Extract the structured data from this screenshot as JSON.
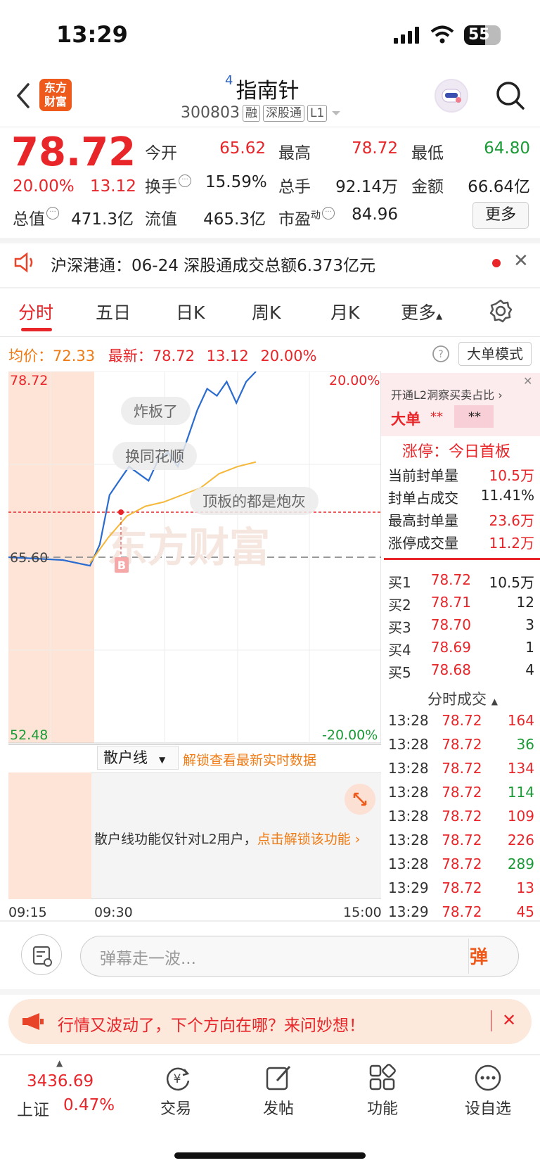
{
  "status_bar": {
    "time": "13:29",
    "battery": "55"
  },
  "header": {
    "logo_text": "东方财富",
    "stock_index": "4",
    "stock_name": "指南针",
    "stock_code": "300803",
    "tags": [
      "融",
      "深股通",
      "L1"
    ]
  },
  "quote": {
    "price": "78.72",
    "change_pct": "20.00%",
    "change": "13.12",
    "stats": [
      {
        "label": "今开",
        "value": "65.62",
        "color": "red"
      },
      {
        "label": "最高",
        "value": "78.72",
        "color": "red"
      },
      {
        "label": "最低",
        "value": "64.80",
        "color": "green"
      },
      {
        "label": "换手",
        "value": "15.59%",
        "color": "black"
      },
      {
        "label": "总手",
        "value": "92.14万",
        "color": "black"
      },
      {
        "label": "金额",
        "value": "66.64亿",
        "color": "black"
      },
      {
        "label": "总值",
        "value": "471.3亿",
        "color": "black"
      },
      {
        "label": "流值",
        "value": "465.3亿",
        "color": "black"
      },
      {
        "label": "市盈",
        "label_sup": "动",
        "value": "84.96",
        "color": "black"
      }
    ],
    "more_label": "更多"
  },
  "notice": {
    "text": "沪深港通：06-24 深股通成交总额6.373亿元"
  },
  "tabs": [
    "分时",
    "五日",
    "日K",
    "周K",
    "月K",
    "更多"
  ],
  "chart": {
    "avg_label": "均价：",
    "avg_value": "72.33",
    "latest_label": "最新：",
    "latest_value": "78.72",
    "latest_change": "13.12",
    "latest_pct": "20.00%",
    "big_order_mode": "大单模式",
    "y_top": "78.72",
    "y_mid": "65.60",
    "y_bottom": "52.48",
    "pct_top": "20.00%",
    "pct_bottom": "-20.00%",
    "danmaku": [
      "炸板了",
      "换同花顺",
      "顶板的都是炮灰"
    ],
    "watermark": "东方财富",
    "buy_marker": "B",
    "sub_chart_select": "散户线",
    "sub_chart_unlock": "解锁查看最新实时数据",
    "sub_chart_msg": "散户线功能仅针对L2用户，",
    "sub_chart_msg_link": "点击解锁该功能",
    "time_start": "09:15",
    "time_open": "09:30",
    "time_end": "15:00"
  },
  "chart_data": {
    "type": "line",
    "ylim": [
      52.48,
      78.72
    ],
    "series": [
      {
        "values": [
          65.6,
          65.5,
          65.4,
          65.0,
          66.5,
          70.0,
          71.0,
          72.0,
          71.5,
          71.0,
          72.5,
          73.0,
          72.0,
          74.0,
          76.0,
          77.5,
          77.0,
          78.0,
          76.5,
          78.0,
          78.72
        ]
      },
      {
        "values": [
          65.2,
          67.0,
          68.5,
          69.2,
          69.5,
          70.0,
          70.5,
          71.5,
          72.0,
          72.33
        ]
      }
    ]
  },
  "right_panel": {
    "l2_promo": "开通L2洞察买卖占比",
    "big_order_label": "大单",
    "big_order_val1": "**",
    "big_order_val2": "**",
    "limit_up_title": "涨停：今日首板",
    "limit_rows": [
      {
        "label": "当前封单量",
        "value": "10.5万"
      },
      {
        "label": "封单占成交",
        "value": "11.41%"
      },
      {
        "label": "最高封单量",
        "value": "23.6万"
      },
      {
        "label": "涨停成交量",
        "value": "11.2万"
      }
    ],
    "bids": [
      {
        "label": "买1",
        "price": "78.72",
        "vol": "10.5万"
      },
      {
        "label": "买2",
        "price": "78.71",
        "vol": "12"
      },
      {
        "label": "买3",
        "price": "78.70",
        "vol": "3"
      },
      {
        "label": "买4",
        "price": "78.69",
        "vol": "1"
      },
      {
        "label": "买5",
        "price": "78.68",
        "vol": "4"
      }
    ],
    "trades_title": "分时成交",
    "trades": [
      {
        "time": "13:28",
        "price": "78.72",
        "vol": "164",
        "color": "red"
      },
      {
        "time": "13:28",
        "price": "78.72",
        "vol": "36",
        "color": "green"
      },
      {
        "time": "13:28",
        "price": "78.72",
        "vol": "134",
        "color": "red"
      },
      {
        "time": "13:28",
        "price": "78.72",
        "vol": "114",
        "color": "green"
      },
      {
        "time": "13:28",
        "price": "78.72",
        "vol": "109",
        "color": "red"
      },
      {
        "time": "13:28",
        "price": "78.72",
        "vol": "226",
        "color": "red"
      },
      {
        "time": "13:28",
        "price": "78.72",
        "vol": "289",
        "color": "green"
      },
      {
        "time": "13:29",
        "price": "78.72",
        "vol": "13",
        "color": "red"
      },
      {
        "time": "13:29",
        "price": "78.72",
        "vol": "45",
        "color": "red"
      }
    ]
  },
  "comment": {
    "placeholder": "弹幕走一波...",
    "danmu_btn": "弹"
  },
  "promo": {
    "text": "行情又波动了，下个方向在哪？来问妙想！"
  },
  "bottom_nav": {
    "index_value": "3436.69",
    "index_name": "上证",
    "index_pct": "0.47%",
    "items": [
      "交易",
      "发帖",
      "功能",
      "设自选"
    ]
  }
}
